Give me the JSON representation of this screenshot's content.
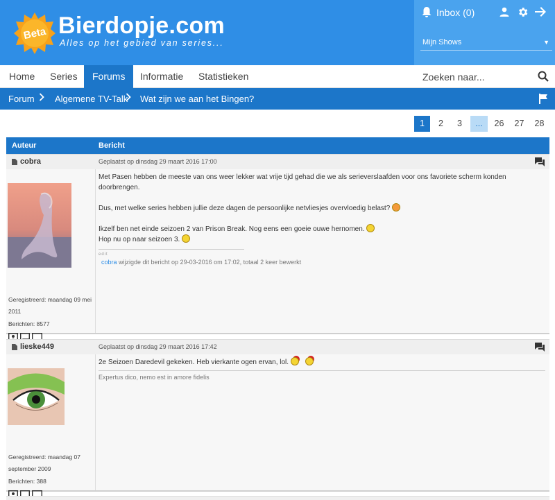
{
  "header": {
    "beta": "Beta",
    "site_name": "Bierdopje.com",
    "tagline": "Alles op het gebied van series...",
    "inbox": "Inbox (0)",
    "shows_select": "Mijn Shows"
  },
  "nav": {
    "items": [
      "Home",
      "Series",
      "Forums",
      "Informatie",
      "Statistieken"
    ],
    "active": "Forums",
    "search_placeholder": "Zoeken naar..."
  },
  "breadcrumb": [
    "Forum",
    "Algemene TV-Talk",
    "Wat zijn we aan het Bingen?"
  ],
  "pagination": {
    "pages": [
      "1",
      "2",
      "3",
      "...",
      "26",
      "27",
      "28"
    ],
    "current": "1"
  },
  "table": {
    "col_author": "Auteur",
    "col_message": "Bericht"
  },
  "posts": [
    {
      "author": "cobra",
      "date": "Geplaatst op dinsdag 29 maart 2016 17:00",
      "registered": "Geregistreerd: maandag 09 mei 2011",
      "messages": "Berichten: 8577",
      "line1": "Met Pasen hebben de meeste van ons weer lekker wat vrije tijd gehad die we als serieverslaafden voor ons favoriete scherm konden doorbrengen.",
      "line2": "Dus, met welke series hebben jullie deze dagen de persoonlijke netvliesjes overvloedig belast?",
      "line3": "Ikzelf ben net einde seizoen 2 van Prison Break. Nog eens een goeie ouwe hernomen.",
      "line4": "Hop nu op naar seizoen 3.",
      "edit_label": "edit",
      "edit_user": "cobra",
      "edit_text": " wijzigde dit bericht op 29-03-2016 om 17:02, totaal 2 keer bewerkt"
    },
    {
      "author": "lieske449",
      "date": "Geplaatst op dinsdag 29 maart 2016 17:42",
      "registered": "Geregistreerd: maandag 07 september 2009",
      "messages": "Berichten: 388",
      "line1": "2e Seizoen Daredevil gekeken. Heb vierkante ogen ervan, lol.",
      "signature": "Expertus dico, nemo est in amore fidelis"
    }
  ]
}
